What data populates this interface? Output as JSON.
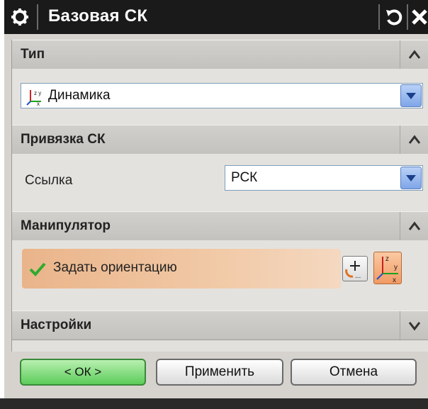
{
  "titlebar": {
    "title": "Базовая СК",
    "icons": [
      "gear-icon",
      "reset-icon",
      "close-icon"
    ]
  },
  "sections": {
    "type": {
      "header": "Тип",
      "combo_value": "Динамика",
      "expanded": true
    },
    "anchor": {
      "header": "Привязка СК",
      "field_label": "Ссылка",
      "combo_value": "РСК",
      "expanded": true
    },
    "manipulator": {
      "header": "Манипулятор",
      "row_label": "Задать ориентацию",
      "expanded": true
    },
    "settings": {
      "header": "Настройки",
      "expanded": false
    }
  },
  "buttons": {
    "ok": "< ОК >",
    "apply": "Применить",
    "cancel": "Отмена"
  },
  "colors": {
    "ok_button": "#5ccc5a",
    "orient_row": "#eab48a",
    "active_csys_button": "#f19a64",
    "check": "#2faa2f"
  }
}
